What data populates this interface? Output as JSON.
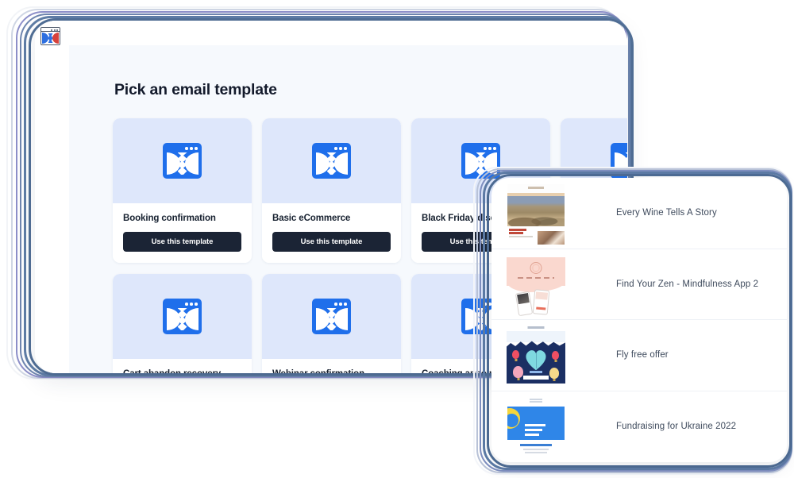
{
  "browser": {
    "logo_icon": "broken-image-logo-icon"
  },
  "page": {
    "title": "Pick an email template"
  },
  "templates": {
    "button_label": "Use this template",
    "thumb_icon": "broken-image-icon",
    "items": [
      {
        "name": "Booking confirmation"
      },
      {
        "name": "Basic eCommerce"
      },
      {
        "name": "Black Friday discount"
      },
      {
        "name": ""
      },
      {
        "name": "Cart abandon recovery"
      },
      {
        "name": "Webinar confirmation"
      },
      {
        "name": "Coaching appointment"
      },
      {
        "name": ""
      }
    ]
  },
  "email_panel": {
    "rows": [
      {
        "title": "Every Wine Tells A Story",
        "thumb": "wine-vineyard-thumbnail"
      },
      {
        "title": "Find Your Zen - Mindfulness App 2",
        "thumb": "mindfulness-app-thumbnail"
      },
      {
        "title": "Fly free offer",
        "thumb": "hot-air-balloons-thumbnail"
      },
      {
        "title": "Fundraising for Ukraine 2022",
        "thumb": "ukraine-fundraising-thumbnail"
      }
    ]
  },
  "colors": {
    "accent_blue": "#1f6feb",
    "card_thumb_bg": "#dee7fb",
    "button_dark": "#1b2435",
    "page_bg": "#f6f9fd",
    "frame_slate": "#4e6c94"
  }
}
